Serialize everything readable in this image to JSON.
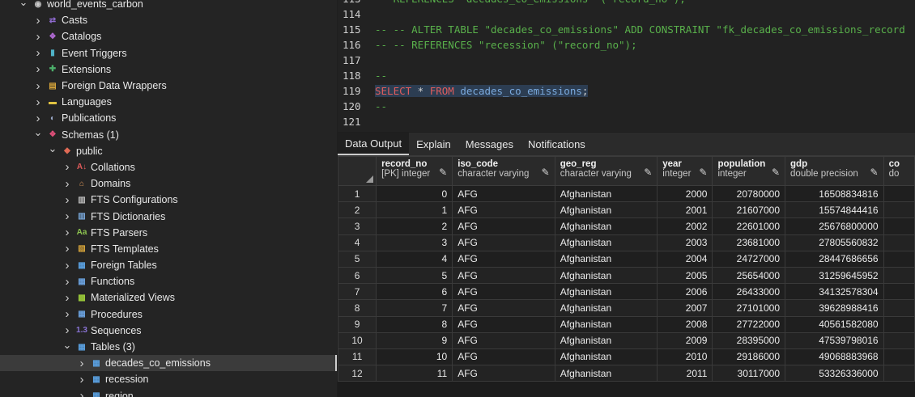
{
  "tree": {
    "nodes": [
      {
        "label": "world_events_carbon",
        "expanded": true,
        "depth": 1,
        "icon": "database-icon",
        "color": "#c9c9c9",
        "glyph": "◉"
      },
      {
        "label": "Casts",
        "expanded": false,
        "depth": 2,
        "icon": "casts-icon",
        "color": "#8f6bd1",
        "glyph": "⇄"
      },
      {
        "label": "Catalogs",
        "expanded": false,
        "depth": 2,
        "icon": "catalogs-icon",
        "color": "#b06ad3",
        "glyph": "❖"
      },
      {
        "label": "Event Triggers",
        "expanded": false,
        "depth": 2,
        "icon": "event-triggers-icon",
        "color": "#4fb3c8",
        "glyph": "▮"
      },
      {
        "label": "Extensions",
        "expanded": false,
        "depth": 2,
        "icon": "extensions-icon",
        "color": "#4caf6b",
        "glyph": "✚"
      },
      {
        "label": "Foreign Data Wrappers",
        "expanded": false,
        "depth": 2,
        "icon": "fdw-icon",
        "color": "#d6a43a",
        "glyph": "▤"
      },
      {
        "label": "Languages",
        "expanded": false,
        "depth": 2,
        "icon": "languages-icon",
        "color": "#e0c341",
        "glyph": "▬"
      },
      {
        "label": "Publications",
        "expanded": false,
        "depth": 2,
        "icon": "publications-icon",
        "color": "#9aa8c8",
        "glyph": "◐"
      },
      {
        "label": "Schemas (1)",
        "expanded": true,
        "depth": 2,
        "icon": "schemas-icon",
        "color": "#e0507a",
        "glyph": "❖"
      },
      {
        "label": "public",
        "expanded": true,
        "depth": 3,
        "icon": "schema-public-icon",
        "color": "#e06a55",
        "glyph": "◆"
      },
      {
        "label": "Collations",
        "expanded": false,
        "depth": 4,
        "icon": "collations-icon",
        "color": "#e05a5a",
        "glyph": "A↓"
      },
      {
        "label": "Domains",
        "expanded": false,
        "depth": 4,
        "icon": "domains-icon",
        "color": "#d9955a",
        "glyph": "⌂"
      },
      {
        "label": "FTS Configurations",
        "expanded": false,
        "depth": 4,
        "icon": "fts-configurations-icon",
        "color": "#bdbdbd",
        "glyph": "▥"
      },
      {
        "label": "FTS Dictionaries",
        "expanded": false,
        "depth": 4,
        "icon": "fts-dictionaries-icon",
        "color": "#7aa9dc",
        "glyph": "▥"
      },
      {
        "label": "FTS Parsers",
        "expanded": false,
        "depth": 4,
        "icon": "fts-parsers-icon",
        "color": "#8cc24f",
        "glyph": "Aa"
      },
      {
        "label": "FTS Templates",
        "expanded": false,
        "depth": 4,
        "icon": "fts-templates-icon",
        "color": "#d6a43a",
        "glyph": "▧"
      },
      {
        "label": "Foreign Tables",
        "expanded": false,
        "depth": 4,
        "icon": "foreign-tables-icon",
        "color": "#5aa0e0",
        "glyph": "▦"
      },
      {
        "label": "Functions",
        "expanded": false,
        "depth": 4,
        "icon": "functions-icon",
        "color": "#6aa0dc",
        "glyph": "▦"
      },
      {
        "label": "Materialized Views",
        "expanded": false,
        "depth": 4,
        "icon": "materialized-views-icon",
        "color": "#9ccc3a",
        "glyph": "▩"
      },
      {
        "label": "Procedures",
        "expanded": false,
        "depth": 4,
        "icon": "procedures-icon",
        "color": "#6aa0dc",
        "glyph": "▦"
      },
      {
        "label": "Sequences",
        "expanded": false,
        "depth": 4,
        "icon": "sequences-icon",
        "color": "#8a74d6",
        "glyph": "1.3"
      },
      {
        "label": "Tables (3)",
        "expanded": true,
        "depth": 4,
        "icon": "tables-icon",
        "color": "#5aa0e0",
        "glyph": "▦"
      },
      {
        "label": "decades_co_emissions",
        "expanded": false,
        "depth": 5,
        "icon": "table-icon",
        "color": "#5aa0e0",
        "glyph": "▦",
        "selected": true
      },
      {
        "label": "recession",
        "expanded": false,
        "depth": 5,
        "icon": "table-icon",
        "color": "#5aa0e0",
        "glyph": "▦"
      },
      {
        "label": "region",
        "expanded": false,
        "depth": 5,
        "icon": "table-icon",
        "color": "#5aa0e0",
        "glyph": "▦"
      }
    ]
  },
  "editor": {
    "lines": [
      {
        "num": "113",
        "segments": [
          {
            "t": "   REFERENCES \"decades_co_emissions\" (\"record_no\");",
            "c": "cmt"
          }
        ]
      },
      {
        "num": "114",
        "segments": []
      },
      {
        "num": "115",
        "segments": [
          {
            "t": "-- -- ALTER TABLE \"decades_co_emissions\" ADD CONSTRAINT \"fk_decades_co_emissions_record",
            "c": "cmt"
          }
        ]
      },
      {
        "num": "116",
        "segments": [
          {
            "t": "-- -- REFERENCES \"recession\" (\"record_no\");",
            "c": "cmt"
          }
        ]
      },
      {
        "num": "117",
        "segments": []
      },
      {
        "num": "118",
        "segments": [
          {
            "t": "--",
            "c": "cmt"
          }
        ]
      },
      {
        "num": "119",
        "highlight": true,
        "segments": [
          {
            "t": "SELECT",
            "c": "kw"
          },
          {
            "t": " * ",
            "c": "plain"
          },
          {
            "t": "FROM",
            "c": "kw"
          },
          {
            "t": " decades_co_emissions",
            "c": "ident"
          },
          {
            "t": ";",
            "c": "plain"
          }
        ]
      },
      {
        "num": "120",
        "segments": [
          {
            "t": "--",
            "c": "cmt"
          }
        ]
      },
      {
        "num": "121",
        "segments": []
      }
    ]
  },
  "tabs": [
    {
      "label": "Data Output",
      "active": true
    },
    {
      "label": "Explain",
      "active": false
    },
    {
      "label": "Messages",
      "active": false
    },
    {
      "label": "Notifications",
      "active": false
    }
  ],
  "grid": {
    "columns": [
      {
        "name": "record_no",
        "type": "[PK] integer",
        "numeric": true
      },
      {
        "name": "iso_code",
        "type": "character varying",
        "numeric": false
      },
      {
        "name": "geo_reg",
        "type": "character varying",
        "numeric": false
      },
      {
        "name": "year",
        "type": "integer",
        "numeric": true
      },
      {
        "name": "population",
        "type": "integer",
        "numeric": true
      },
      {
        "name": "gdp",
        "type": "double precision",
        "numeric": true
      },
      {
        "name": "co",
        "type": "do",
        "numeric": true
      }
    ],
    "rows": [
      {
        "n": "1",
        "cells": [
          "0",
          "AFG",
          "Afghanistan",
          "2000",
          "20780000",
          "16508834816",
          ""
        ]
      },
      {
        "n": "2",
        "cells": [
          "1",
          "AFG",
          "Afghanistan",
          "2001",
          "21607000",
          "15574844416",
          ""
        ]
      },
      {
        "n": "3",
        "cells": [
          "2",
          "AFG",
          "Afghanistan",
          "2002",
          "22601000",
          "25676800000",
          ""
        ]
      },
      {
        "n": "4",
        "cells": [
          "3",
          "AFG",
          "Afghanistan",
          "2003",
          "23681000",
          "27805560832",
          ""
        ]
      },
      {
        "n": "5",
        "cells": [
          "4",
          "AFG",
          "Afghanistan",
          "2004",
          "24727000",
          "28447686656",
          ""
        ]
      },
      {
        "n": "6",
        "cells": [
          "5",
          "AFG",
          "Afghanistan",
          "2005",
          "25654000",
          "31259645952",
          ""
        ]
      },
      {
        "n": "7",
        "cells": [
          "6",
          "AFG",
          "Afghanistan",
          "2006",
          "26433000",
          "34132578304",
          ""
        ]
      },
      {
        "n": "8",
        "cells": [
          "7",
          "AFG",
          "Afghanistan",
          "2007",
          "27101000",
          "39628988416",
          ""
        ]
      },
      {
        "n": "9",
        "cells": [
          "8",
          "AFG",
          "Afghanistan",
          "2008",
          "27722000",
          "40561582080",
          ""
        ]
      },
      {
        "n": "10",
        "cells": [
          "9",
          "AFG",
          "Afghanistan",
          "2009",
          "28395000",
          "47539798016",
          ""
        ]
      },
      {
        "n": "11",
        "cells": [
          "10",
          "AFG",
          "Afghanistan",
          "2010",
          "29186000",
          "49068883968",
          ""
        ]
      },
      {
        "n": "12",
        "cells": [
          "11",
          "AFG",
          "Afghanistan",
          "2011",
          "30117000",
          "53326336000",
          ""
        ]
      }
    ]
  }
}
